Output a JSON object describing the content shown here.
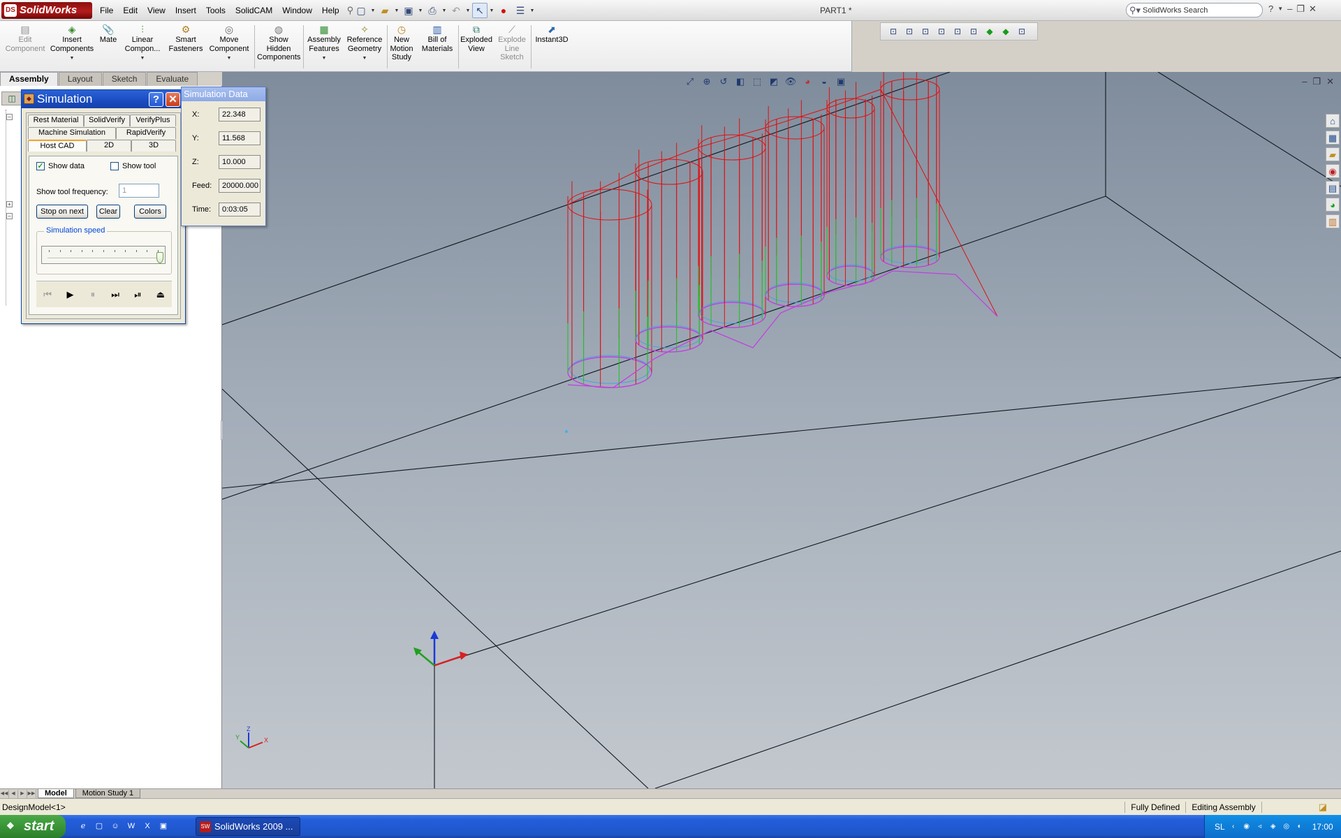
{
  "app": {
    "logo": "SolidWorks",
    "document_title": "PART1 *",
    "menu": [
      "File",
      "Edit",
      "View",
      "Insert",
      "Tools",
      "SolidCAM",
      "Window",
      "Help"
    ],
    "search_placeholder": "SolidWorks Search"
  },
  "command_manager": {
    "buttons": [
      {
        "label": "Edit\nComponent",
        "icon": "edit-component-icon",
        "enabled": false
      },
      {
        "label": "Insert\nComponents",
        "icon": "insert-components-icon",
        "enabled": true
      },
      {
        "label": "Mate",
        "icon": "mate-icon",
        "enabled": true
      },
      {
        "label": "Linear\nCompon...",
        "icon": "linear-pattern-icon",
        "enabled": true
      },
      {
        "label": "Smart\nFasteners",
        "icon": "smart-fasteners-icon",
        "enabled": true
      },
      {
        "label": "Move\nComponent",
        "icon": "move-component-icon",
        "enabled": true
      },
      {
        "label": "Show\nHidden\nComponents",
        "icon": "show-hidden-icon",
        "enabled": true
      },
      {
        "label": "Assembly\nFeatures",
        "icon": "assembly-features-icon",
        "enabled": true
      },
      {
        "label": "Reference\nGeometry",
        "icon": "reference-geometry-icon",
        "enabled": true
      },
      {
        "label": "New\nMotion\nStudy",
        "icon": "motion-study-icon",
        "enabled": true
      },
      {
        "label": "Bill of\nMaterials",
        "icon": "bom-icon",
        "enabled": true
      },
      {
        "label": "Exploded\nView",
        "icon": "exploded-view-icon",
        "enabled": true
      },
      {
        "label": "Explode\nLine\nSketch",
        "icon": "explode-line-icon",
        "enabled": false
      },
      {
        "label": "Instant3D",
        "icon": "instant3d-icon",
        "enabled": true
      }
    ],
    "tabs": [
      "Assembly",
      "Layout",
      "Sketch",
      "Evaluate"
    ],
    "active_tab": "Assembly"
  },
  "simulation": {
    "title": "Simulation",
    "tabs_row1": [
      "Rest Material",
      "SolidVerify",
      "VerifyPlus"
    ],
    "tabs_row2": [
      "Machine Simulation",
      "RapidVerify"
    ],
    "tabs_row3": [
      "Host CAD",
      "2D",
      "3D"
    ],
    "active_tab": "Host CAD",
    "show_data_label": "Show data",
    "show_data_checked": true,
    "show_tool_label": "Show tool",
    "show_tool_checked": false,
    "show_tool_frequency_label": "Show tool frequency:",
    "show_tool_frequency_value": "1",
    "buttons": [
      "Stop on next",
      "Clear",
      "Colors"
    ],
    "speed_label": "Simulation speed",
    "speed_level": 1.0
  },
  "simulation_data": {
    "title": "Simulation Data",
    "fields": [
      {
        "label": "X:",
        "value": "22.348"
      },
      {
        "label": "Y:",
        "value": "11.568"
      },
      {
        "label": "Z:",
        "value": "10.000"
      },
      {
        "label": "Feed:",
        "value": "20000.000"
      },
      {
        "label": "Time:",
        "value": "0:03:05"
      }
    ]
  },
  "viewport": {
    "background_top": "#7f8c9c",
    "background_bottom": "#c3c8ce",
    "toolpath_rapid_color": "#e01010",
    "toolpath_feed_color": "#20c020",
    "toolpath_contour_color": "#c040e0",
    "triad_labels": [
      "X",
      "Y",
      "Z"
    ]
  },
  "bottom_tabs": [
    "Model",
    "Motion Study 1"
  ],
  "status": {
    "left": "DesignModel<1>",
    "state": "Fully Defined",
    "mode": "Editing Assembly"
  },
  "taskbar": {
    "start": "start",
    "task": "SolidWorks 2009 ...",
    "lang": "SL",
    "clock": "17:00"
  }
}
